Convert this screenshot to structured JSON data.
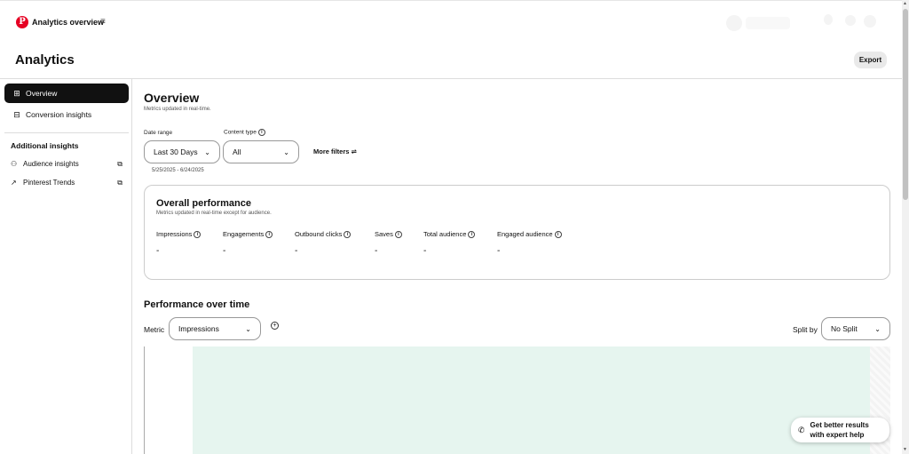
{
  "header": {
    "logo": "P",
    "app_title": "Analytics overview",
    "menu_icon": "≡"
  },
  "page": {
    "title": "Analytics",
    "export_label": "Export"
  },
  "sidebar": {
    "items": [
      {
        "label": "Overview",
        "icon": "grid-icon",
        "glyph": "⊞"
      },
      {
        "label": "Conversion insights",
        "icon": "conversion-icon",
        "glyph": "⊟"
      }
    ],
    "additional_heading": "Additional insights",
    "external_items": [
      {
        "label": "Audience insights",
        "icon": "person-icon",
        "glyph": "⚇"
      },
      {
        "label": "Pinterest Trends",
        "icon": "trend-icon",
        "glyph": "↗"
      }
    ],
    "external_glyph": "⧉"
  },
  "overview": {
    "title": "Overview",
    "subtitle": "Metrics updated in real-time.",
    "date_range_label": "Date range",
    "date_range_value": "Last 30 Days",
    "content_type_label": "Content type",
    "content_type_value": "All",
    "more_filters": "More filters ⇌",
    "date_span": "5/25/2025 - 6/24/2025"
  },
  "performance": {
    "title": "Overall performance",
    "subtitle": "Metrics updated in real-time except for audience.",
    "metrics": [
      {
        "label": "Impressions",
        "value": "-"
      },
      {
        "label": "Engagements",
        "value": "-"
      },
      {
        "label": "Outbound clicks",
        "value": "-"
      },
      {
        "label": "Saves",
        "value": "-"
      },
      {
        "label": "Total audience",
        "value": "-"
      },
      {
        "label": "Engaged audience",
        "value": "-"
      }
    ]
  },
  "over_time": {
    "title": "Performance over time",
    "metric_label": "Metric",
    "metric_value": "Impressions",
    "split_label": "Split by",
    "split_value": "No Split"
  },
  "help": {
    "line1": "Get better results",
    "line2": "with expert help"
  },
  "colors": {
    "brand": "#e60023",
    "chart_fill": "#e6f5ef"
  }
}
